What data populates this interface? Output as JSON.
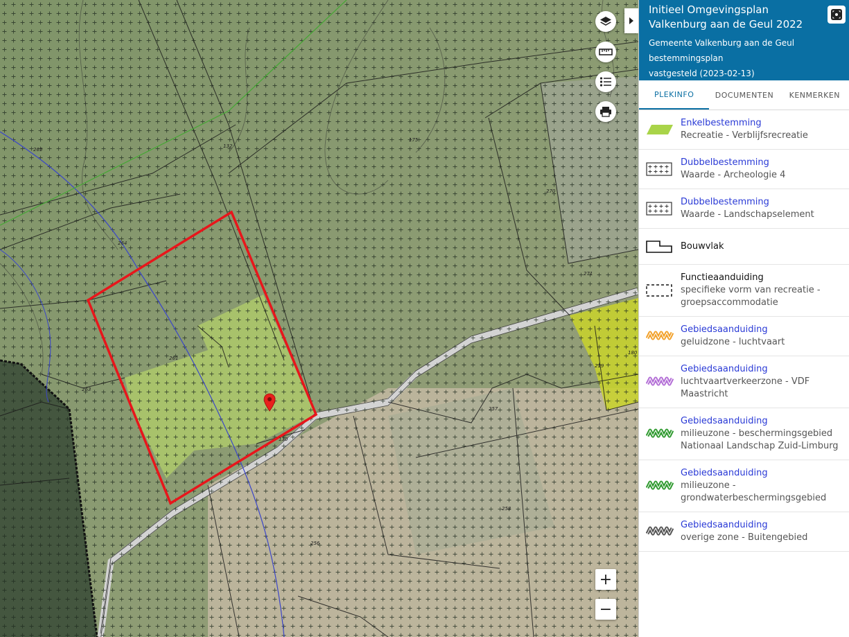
{
  "map": {
    "parcel_labels": [
      "265",
      "132",
      "175",
      "264",
      "270",
      "271",
      "261",
      "263",
      "130",
      "257",
      "219",
      "180",
      "258",
      "256"
    ],
    "colors": {
      "selection": "#e8161b",
      "pin": "#e8211d",
      "recreation_fill": "#b5d36a",
      "yellow_fill": "#c9d32a",
      "blue_line": "#3a45c9",
      "green_line": "#43a832"
    },
    "controls": {
      "layers_icon": "layers-icon",
      "measure_icon": "ruler-icon",
      "legend_icon": "list-icon",
      "print_icon": "printer-icon",
      "zoom_in": "+",
      "zoom_out": "−",
      "collapse_icon": "chevron-right-icon"
    }
  },
  "panel": {
    "title": "Initieel Omgevingsplan Valkenburg aan de Geul 2022",
    "municipality": "Gemeente Valkenburg aan de Geul",
    "plan_type": "bestemmingsplan",
    "status": "vastgesteld (2023-02-13)",
    "fit_icon": "zoom-to-extent-icon",
    "tabs": [
      {
        "label": "PLEKINFO",
        "active": true
      },
      {
        "label": "DOCUMENTEN",
        "active": false
      },
      {
        "label": "KENMERKEN",
        "active": false
      }
    ],
    "entries": [
      {
        "symbol": "green-parallelogram",
        "title": "Enkelbestemming",
        "link": true,
        "sub": "Recreatie - Verblijfsrecreatie"
      },
      {
        "symbol": "plus-grid",
        "title": "Dubbelbestemming",
        "link": true,
        "sub": "Waarde - Archeologie 4"
      },
      {
        "symbol": "plus-grid",
        "title": "Dubbelbestemming",
        "link": true,
        "sub": "Waarde - Landschapselement"
      },
      {
        "symbol": "bouwvlak",
        "title": "Bouwvlak",
        "link": false,
        "sub": ""
      },
      {
        "symbol": "dashed-rect",
        "title": "Functieaanduiding",
        "link": false,
        "sub": "specifieke vorm van recreatie - groepsaccommodatie"
      },
      {
        "symbol": "zigzag-orange",
        "title": "Gebiedsaanduiding",
        "link": true,
        "sub": "geluidzone - luchtvaart"
      },
      {
        "symbol": "zigzag-purple",
        "title": "Gebiedsaanduiding",
        "link": true,
        "sub": "luchtvaartverkeerzone - VDF Maastricht"
      },
      {
        "symbol": "zigzag-green",
        "title": "Gebiedsaanduiding",
        "link": true,
        "sub": "milieuzone - beschermingsgebied Nationaal Landschap Zuid-Limburg"
      },
      {
        "symbol": "zigzag-green",
        "title": "Gebiedsaanduiding",
        "link": true,
        "sub": "milieuzone - grondwaterbeschermingsgebied"
      },
      {
        "symbol": "zigzag-grey",
        "title": "Gebiedsaanduiding",
        "link": true,
        "sub": "overige zone - Buitengebied"
      }
    ],
    "symbol_colors": {
      "green": "#a9d449",
      "orange": "#f2a12a",
      "purple": "#b36ed6",
      "zgreen": "#2f9a2f",
      "grey": "#555555"
    }
  }
}
